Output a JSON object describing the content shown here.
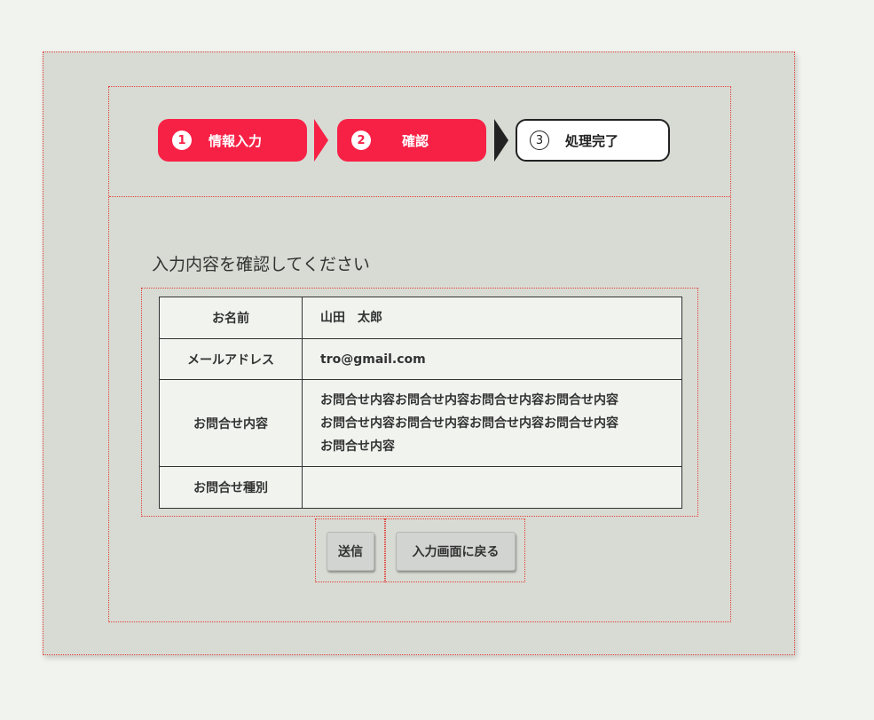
{
  "steps": [
    {
      "number": "1",
      "label": "情報入力",
      "state": "active"
    },
    {
      "number": "2",
      "label": "確認",
      "state": "active"
    },
    {
      "number": "3",
      "label": "処理完了",
      "state": "pending"
    }
  ],
  "main": {
    "title": "入力内容を確認してください"
  },
  "confirm_table": {
    "rows": [
      {
        "label": "お名前",
        "value": "山田　太郎"
      },
      {
        "label": "メールアドレス",
        "value": "tro@gmail.com"
      },
      {
        "label": "お問合せ内容",
        "value_lines": [
          "お問合せ内容お問合せ内容お問合せ内容お問合せ内容",
          "お問合せ内容お問合せ内容お問合せ内容お問合せ内容",
          "お問合せ内容"
        ]
      },
      {
        "label": "お問合せ種別",
        "value": ""
      }
    ]
  },
  "actions": {
    "submit_label": "送信",
    "back_label": "入力画面に戻る"
  },
  "colors": {
    "accent": "#f72146",
    "panel": "#d8dbd3",
    "page_bg": "#f1f3ef"
  }
}
